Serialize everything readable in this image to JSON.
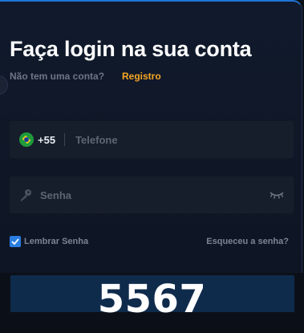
{
  "login": {
    "title": "Faça login na sua conta",
    "no_account_text": "Não tem uma conta?",
    "register_link": "Registro"
  },
  "phone": {
    "flag_icon": "brazil-flag-icon",
    "country_code": "+55",
    "placeholder": "Telefone",
    "value": ""
  },
  "password": {
    "key_icon": "key-icon",
    "placeholder": "Senha",
    "value": "",
    "visibility_icon": "eye-closed-icon"
  },
  "remember": {
    "label": "Lembrar Senha",
    "checked": true
  },
  "forgot_link": "Esqueceu a senha?",
  "overlay": {
    "code": "5567"
  },
  "colors": {
    "accent": "#f5a623",
    "checkbox": "#2a7de1",
    "border": "#1f74d6",
    "button": "#0f2b4c"
  }
}
